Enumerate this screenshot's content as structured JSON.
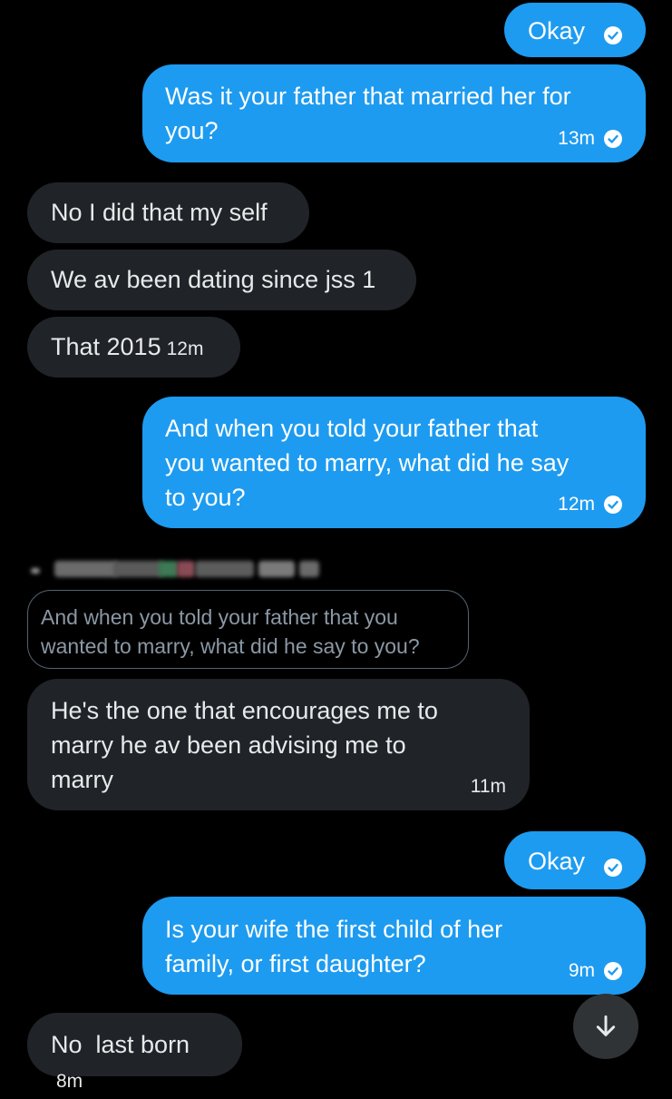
{
  "messages": [
    {
      "text": "Okay"
    },
    {
      "text": "Was it your father that married her for\nyou?",
      "time": "13m"
    },
    {
      "text": "No I did that my self"
    },
    {
      "text": "We av been dating since jss 1"
    },
    {
      "text": "That 2015",
      "time": "12m"
    },
    {
      "text": "And when you told your father that\nyou wanted to marry, what did he say\nto you?",
      "time": "12m"
    },
    {
      "quote": "And when you told your father that you\nwanted to marry, what did he say to you?",
      "text": "He's the one that encourages me to\nmarry he av been advising me to\nmarry",
      "time": "11m"
    },
    {
      "text": "Okay"
    },
    {
      "text": "Is your wife the first child of her\nfamily, or first daughter?",
      "time": "9m"
    },
    {
      "text": "No  last born",
      "time": "8m"
    }
  ],
  "colors": {
    "sent_bubble": "#1d9bf0",
    "received_bubble": "#202327",
    "background": "#000000"
  },
  "icons": {
    "read_receipt": "check-circle-icon",
    "scroll": "arrow-down-icon"
  }
}
